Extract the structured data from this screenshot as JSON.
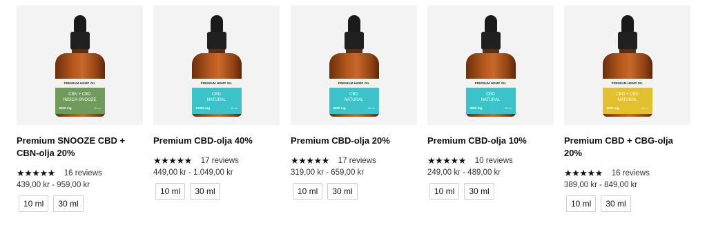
{
  "products": [
    {
      "title": "Premium SNOOZE CBD + CBN-olja 20%",
      "stars": "★★★★★",
      "rating": 5,
      "reviews": "16 reviews",
      "price": "439,00 kr - 959,00 kr",
      "variants": [
        "10 ml",
        "30 ml"
      ],
      "label_color": "#6f9b5c",
      "label_line1": "CBN + CBD",
      "label_line2": "INDICA-SNOOZE",
      "label_mg": "6000 mg",
      "label_ml": "30 ml",
      "brand_label": "PREMIUM HEMP OIL"
    },
    {
      "title": "Premium CBD-olja 40%",
      "stars": "★★★★★",
      "rating": 5,
      "reviews": "17 reviews",
      "price": "449,00 kr - 1.049,00 kr",
      "variants": [
        "10 ml",
        "30 ml"
      ],
      "label_color": "#3cc3c9",
      "label_line1": "CBD",
      "label_line2": "NATURAL",
      "label_mg": "12000 mg",
      "label_ml": "30 ml",
      "brand_label": "PREMIUM HEMP OIL"
    },
    {
      "title": "Premium CBD-olja 20%",
      "stars": "★★★★★",
      "rating": 5,
      "reviews": "17 reviews",
      "price": "319,00 kr - 659,00 kr",
      "variants": [
        "10 ml",
        "30 ml"
      ],
      "label_color": "#3cc3c9",
      "label_line1": "CBD",
      "label_line2": "NATURAL",
      "label_mg": "6000 mg",
      "label_ml": "30 ml",
      "brand_label": "PREMIUM HEMP OIL"
    },
    {
      "title": "Premium CBD-olja 10%",
      "stars": "★★★★★",
      "rating": 5,
      "reviews": "10 reviews",
      "price": "249,00 kr - 489,00 kr",
      "variants": [
        "10 ml",
        "30 ml"
      ],
      "label_color": "#3cc3c9",
      "label_line1": "CBD",
      "label_line2": "NATURAL",
      "label_mg": "3000 mg",
      "label_ml": "30 ml",
      "brand_label": "PREMIUM HEMP OIL"
    },
    {
      "title": "Premium CBD + CBG-olja 20%",
      "stars": "★★★★★",
      "rating": 4.5,
      "reviews": "16 reviews",
      "price": "389,00 kr - 849,00 kr",
      "variants": [
        "10 ml",
        "30 ml"
      ],
      "label_color": "#e2c02f",
      "label_line1": "CBG + CBD",
      "label_line2": "NATURAL",
      "label_mg": "6000 mg",
      "label_ml": "30 ml",
      "brand_label": "PREMIUM HEMP OIL"
    }
  ]
}
